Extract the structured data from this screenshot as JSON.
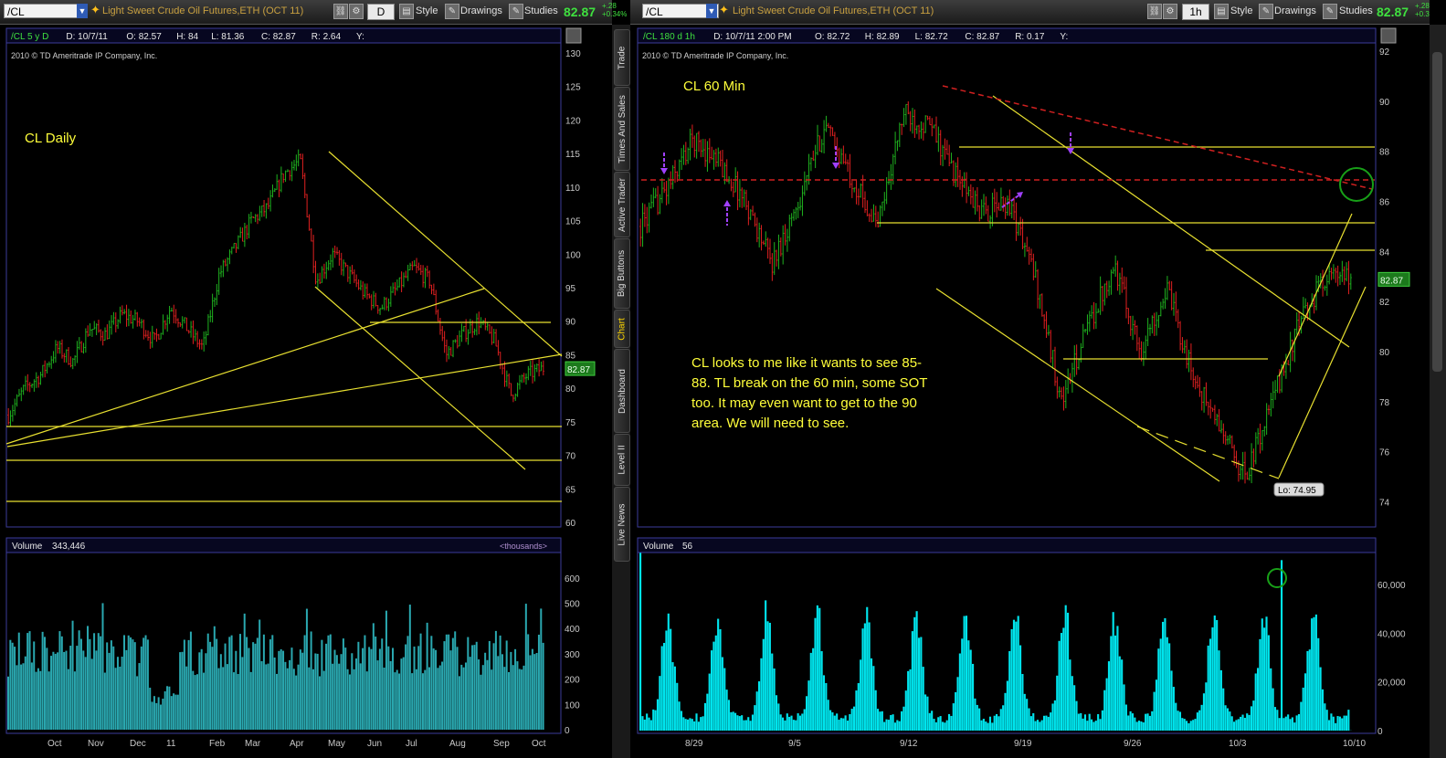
{
  "left": {
    "symbol": "/CL",
    "title": "Light Sweet Crude Oil Futures,ETH (OCT 11)",
    "aggregation": "D",
    "style_label": "Style",
    "drawings_label": "Drawings",
    "studies_label": "Studies",
    "price": "82.87",
    "change_top": "+.28",
    "change_bottom": "+0.34%",
    "header_fields": [
      "/CL 5 y D",
      "D: 10/7/11",
      "O: 82.57",
      "H: 84",
      "L: 81.36",
      "C: 82.87",
      "R: 2.64",
      "Y:"
    ],
    "copyright": "2010 © TD Ameritrade IP Company, Inc.",
    "annotation": "CL Daily",
    "price_tag": "82.87",
    "volume_label": "Volume",
    "volume_value": "343,446",
    "volume_units": "<thousands>"
  },
  "right": {
    "symbol": "/CL",
    "title": "Light Sweet Crude Oil Futures,ETH (OCT 11)",
    "aggregation": "1h",
    "style_label": "Style",
    "drawings_label": "Drawings",
    "studies_label": "Studies",
    "price": "82.87",
    "change_top": "+.28",
    "change_bottom": "+0.3",
    "header_fields": [
      "/CL 180 d 1h",
      "D: 10/7/11 2:00 PM",
      "O: 82.72",
      "H: 82.89",
      "L: 82.72",
      "C: 82.87",
      "R: 0.17",
      "Y:"
    ],
    "copyright": "2010 © TD Ameritrade IP Company, Inc.",
    "annotation": "CL 60 Min",
    "comment_lines": [
      "CL looks to me like it wants to see 85-",
      "88.  TL break on the 60 min, some SOT",
      "too.  It may even want to get to the 90",
      "area.  We will need to see."
    ],
    "low_label": "Lo: 74.95",
    "price_tag": "82.87",
    "volume_label": "Volume",
    "volume_value": "56"
  },
  "side_tabs": [
    "Trade",
    "Times And Sales",
    "Active Trader",
    "Big Buttons",
    "Chart",
    "Dashboard",
    "Level II",
    "Live News"
  ],
  "chart_data": [
    {
      "type": "candlestick",
      "title": "CL Daily",
      "x_tick_labels": [
        "Oct",
        "Nov",
        "Dec",
        "11",
        "Feb",
        "Mar",
        "Apr",
        "May",
        "Jun",
        "Jul",
        "Aug",
        "Sep",
        "Oct"
      ],
      "y_tick_labels": [
        "130",
        "125",
        "120",
        "115",
        "110",
        "105",
        "100",
        "95",
        "90",
        "85",
        "80",
        "75",
        "70",
        "65",
        "60"
      ],
      "ylim": [
        60,
        130
      ],
      "approx_closes": [
        76,
        80,
        82,
        86,
        84,
        89,
        88,
        91,
        90,
        87,
        92,
        89,
        86,
        97,
        101,
        105,
        107,
        112,
        114,
        96,
        100,
        97,
        94,
        92,
        95,
        98,
        96,
        85,
        88,
        90,
        87,
        79,
        82,
        83
      ],
      "last": 82.87,
      "colors": {
        "up": "#1fb21f",
        "down": "#e02020",
        "lines": "#e8e030"
      }
    },
    {
      "type": "bar",
      "title": "Volume",
      "y_tick_labels": [
        "600",
        "500",
        "400",
        "300",
        "200",
        "100",
        "0"
      ],
      "ylim": [
        0,
        650
      ],
      "units": "thousands",
      "last": 343446,
      "color": "#2aa8b0"
    },
    {
      "type": "candlestick",
      "title": "CL 60 Min",
      "x_tick_labels": [
        "8/29",
        "9/5",
        "9/12",
        "9/19",
        "9/26",
        "10/3",
        "10/10"
      ],
      "y_tick_labels": [
        "92",
        "90",
        "88",
        "86",
        "84",
        "82",
        "80",
        "78",
        "76",
        "74"
      ],
      "ylim": [
        73,
        92
      ],
      "approx_closes": [
        85,
        86.5,
        88.5,
        87.5,
        86,
        83.5,
        86,
        89,
        87,
        85,
        89.5,
        89,
        87,
        85.5,
        86,
        83,
        78,
        81,
        83.5,
        80,
        82.5,
        79,
        77,
        75,
        78,
        81,
        83,
        82.87
      ],
      "low": 74.95,
      "last": 82.87,
      "colors": {
        "up": "#1fb21f",
        "down": "#e02020",
        "lines": "#e8e030",
        "dashed": "#d02020",
        "arrows": "#a040ff",
        "circle": "#18a018"
      }
    },
    {
      "type": "bar",
      "title": "Volume",
      "y_tick_labels": [
        "60,000",
        "40,000",
        "20,000",
        "0"
      ],
      "ylim": [
        0,
        75000
      ],
      "last": 56,
      "color": "#00e5ee"
    }
  ]
}
